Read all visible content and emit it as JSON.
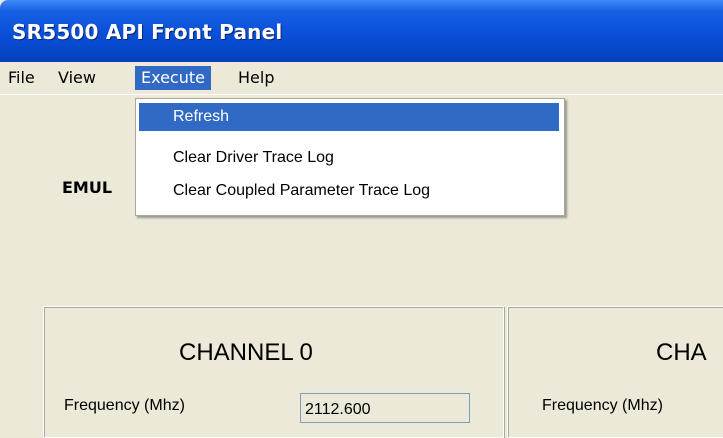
{
  "window": {
    "title": "SR5500 API Front Panel"
  },
  "menubar": {
    "items": [
      {
        "label": "File"
      },
      {
        "label": "View"
      },
      {
        "label": "Execute"
      },
      {
        "label": "Help"
      }
    ]
  },
  "execute_menu": {
    "items": [
      {
        "label": "Refresh"
      },
      {
        "label": "Clear Driver Trace Log"
      },
      {
        "label": "Clear Coupled Parameter Trace Log"
      }
    ]
  },
  "main": {
    "emul_label": "EMUL",
    "channels": [
      {
        "title": "CHANNEL 0",
        "frequency_label": "Frequency (Mhz)",
        "frequency_value": "2112.600"
      },
      {
        "title": "CHA",
        "frequency_label": "Frequency (Mhz)"
      }
    ]
  }
}
